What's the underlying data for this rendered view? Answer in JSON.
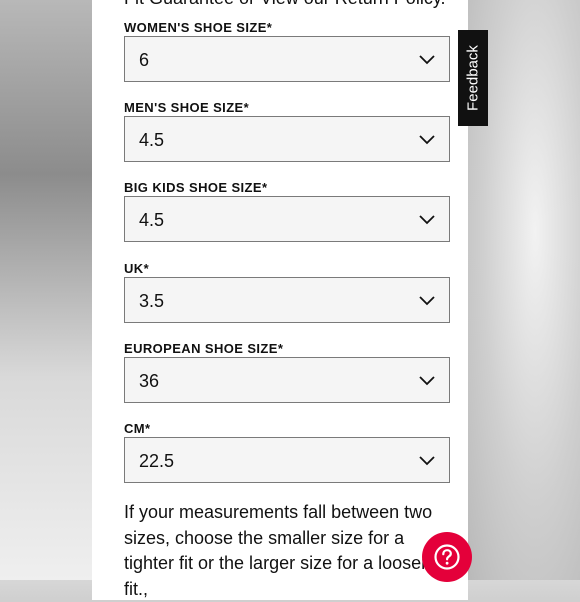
{
  "header_cut_text": "Fit Guarantee or View our Return Policy.",
  "fields": [
    {
      "label": "WOMEN'S SHOE SIZE*",
      "value": "6"
    },
    {
      "label": "MEN'S SHOE SIZE*",
      "value": "4.5"
    },
    {
      "label": "BIG KIDS SHOE SIZE*",
      "value": "4.5"
    },
    {
      "label": "UK*",
      "value": "3.5"
    },
    {
      "label": "EUROPEAN SHOE SIZE*",
      "value": "36"
    },
    {
      "label": "CM*",
      "value": "22.5"
    }
  ],
  "note": "If your measurements fall between two sizes, choose the smaller size for a tighter fit or the larger size for a looser fit.,",
  "feedback_label": "Feedback",
  "colors": {
    "help_button": "#e4003a",
    "feedback_tab": "#111111"
  },
  "icons": {
    "dropdown": "chevron-down-icon",
    "help": "question-circle-icon"
  }
}
